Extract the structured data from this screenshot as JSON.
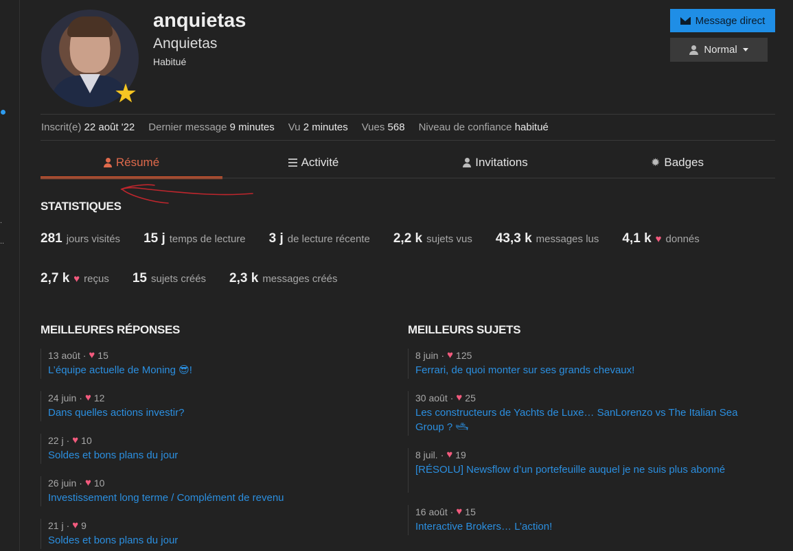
{
  "user": {
    "username": "anquietas",
    "full_name": "Anquietas",
    "title": "Habitué"
  },
  "actions": {
    "message_label": "Message direct",
    "notification_label": "Normal"
  },
  "meta": [
    {
      "key": "Inscrit(e)",
      "value": "22 août '22"
    },
    {
      "key": "Dernier message",
      "value": "9 minutes"
    },
    {
      "key": "Vu",
      "value": "2 minutes"
    },
    {
      "key": "Vues",
      "value": "568"
    },
    {
      "key": "Niveau de confiance",
      "value": "habitué"
    }
  ],
  "tabs": [
    {
      "label": "Résumé",
      "icon": "user-icon",
      "active": true
    },
    {
      "label": "Activité",
      "icon": "list-icon",
      "active": false
    },
    {
      "label": "Invitations",
      "icon": "user-plus-icon",
      "active": false
    },
    {
      "label": "Badges",
      "icon": "badge-icon",
      "active": false
    }
  ],
  "stats": {
    "title": "STATISTIQUES",
    "row1": [
      {
        "num": "281",
        "label": "jours visités"
      },
      {
        "num": "15 j",
        "label": "temps de lecture"
      },
      {
        "num": "3 j",
        "label": "de lecture récente"
      },
      {
        "num": "2,2 k",
        "label": "sujets vus"
      },
      {
        "num": "43,3 k",
        "label": "messages lus"
      },
      {
        "num": "4,1 k",
        "label": "donnés",
        "heart": true
      }
    ],
    "row2": [
      {
        "num": "2,7 k",
        "label": "reçus",
        "heart": true
      },
      {
        "num": "15",
        "label": "sujets créés"
      },
      {
        "num": "2,3 k",
        "label": "messages créés"
      }
    ]
  },
  "top_replies": {
    "title": "MEILLEURES RÉPONSES",
    "items": [
      {
        "date": "13 août",
        "likes": "15",
        "title": "L’équipe actuelle de Moning",
        "suffix": "!"
      },
      {
        "date": "24 juin",
        "likes": "12",
        "title": "Dans quelles actions investir?"
      },
      {
        "date": "22 j",
        "likes": "10",
        "title": "Soldes et bons plans du jour"
      },
      {
        "date": "26 juin",
        "likes": "10",
        "title": "Investissement long terme / Complément de revenu"
      },
      {
        "date": "21 j",
        "likes": "9",
        "title": "Soldes et bons plans du jour"
      }
    ]
  },
  "top_topics": {
    "title": "MEILLEURS SUJETS",
    "items": [
      {
        "date": "8 juin",
        "likes": "125",
        "title": "Ferrari, de quoi monter sur ses grands chevaux!"
      },
      {
        "date": "30 août",
        "likes": "25",
        "title": "Les constructeurs de Yachts de Luxe… SanLorenzo vs The Italian Sea Group ?"
      },
      {
        "date": "8 juil.",
        "likes": "19",
        "title": "[RÉSOLU] Newsflow d’un portefeuille auquel je ne suis plus abonné"
      },
      {
        "date": "16 août",
        "likes": "15",
        "title": "Interactive Brokers… L’action!"
      }
    ]
  },
  "colors": {
    "accent": "#d0552f",
    "link": "#2b8fe0",
    "heart": "#f25a7d",
    "primary_button": "#1f8ee6"
  }
}
